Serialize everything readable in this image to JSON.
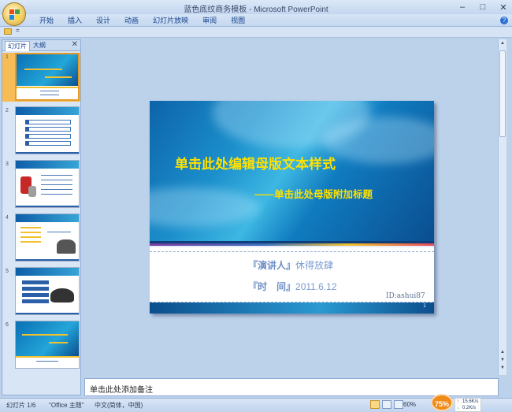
{
  "window": {
    "title": "蓝色底纹商务模板 - Microsoft PowerPoint",
    "controls": [
      "–",
      "□",
      "✕"
    ]
  },
  "ribbon": {
    "tabs": [
      "开始",
      "插入",
      "设计",
      "动画",
      "幻灯片放映",
      "审阅",
      "视图"
    ],
    "help": "?"
  },
  "qat": {
    "arrow": "="
  },
  "panel": {
    "tabs": [
      "幻灯片",
      "大纲"
    ],
    "close": "✕",
    "slides": [
      {
        "num": "1"
      },
      {
        "num": "2"
      },
      {
        "num": "3"
      },
      {
        "num": "4"
      },
      {
        "num": "5"
      },
      {
        "num": "6"
      }
    ]
  },
  "slide": {
    "title": "单击此处编辑母版文本样式",
    "subtitle": "——单击此处母版附加标题",
    "presenter_label": "『演讲人』",
    "presenter_value": "休得放肆",
    "time_label": "『时　间』",
    "time_value": "2011.6.12",
    "id_mark": "ID:ashui87",
    "page_mark": "1"
  },
  "notes": {
    "placeholder": "单击此处添加备注"
  },
  "status": {
    "slide_count": "幻灯片 1/6",
    "theme": "\"Office 主题\"",
    "language": "中文(简体，中国)",
    "zoom_percent": "60%",
    "zoom_badge": "75%",
    "net_up": "15.6K/s",
    "net_down": "0.2K/s"
  },
  "colors": {
    "title_yellow": "#ffe100",
    "selected_thumb": "#f7bc55",
    "ribbon_text": "#15428b"
  }
}
